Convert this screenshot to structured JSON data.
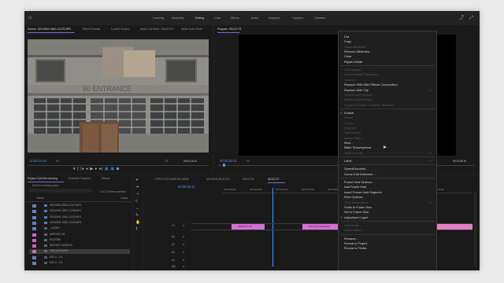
{
  "topbar": {
    "workspaces": [
      "Learning",
      "Assembly",
      "Editing",
      "Color",
      "Effects",
      "Audio",
      "Graphics",
      "Captions",
      "Libraries"
    ],
    "active": "Editing"
  },
  "source_panel": {
    "tabs": [
      "Source: 20210902-0840-C1175.MP4",
      "Effect Controls",
      "Lumetri Scopes",
      "Audio Clip Mixer: SELECTS",
      "Audio Track Mixer"
    ],
    "timecode": "13:03:11:04",
    "fit": "Fit",
    "scale": "1/2",
    "duration": "00:00:14:12",
    "sign_text": "60 ENTRANCE"
  },
  "program_panel": {
    "tab": "Program: SELECTS",
    "timecode": "00:00:20:11",
    "fit": "Fit",
    "scale": "1/2",
    "duration": "00:13:46:19"
  },
  "project_panel": {
    "tabs": [
      "Project: Ep2 this morning",
      "Essential Graphics",
      "Effects"
    ],
    "project_name": "Ep2 this morning.prproj",
    "item_count": "2 of 270 items selected",
    "column_name": "Name",
    "column_fps": "Frame",
    "items": [
      {
        "name": "20210903-1155-C1227.MP4",
        "color": "#5f7fd0",
        "type": "file"
      },
      {
        "name": "20210903-1155-C1228.MP4",
        "color": "#5f7fd0",
        "type": "file"
      },
      {
        "name": "20210903-1156-C1229.MP4",
        "color": "#5f7fd0",
        "type": "file"
      },
      {
        "name": "20210903-1203-C1230.MP4",
        "color": "#5f7fd0",
        "type": "file"
      },
      {
        "name": "_LOOKS",
        "color": "#5f7fd0",
        "type": "folder"
      },
      {
        "name": "AIRPORT US",
        "color": "#e05bcc",
        "type": "item"
      },
      {
        "name": "ROUTINE",
        "color": "#e05bcc",
        "type": "item"
      },
      {
        "name": "DRIVING GENERAL",
        "color": "#e05bcc",
        "type": "item"
      },
      {
        "name": "THIS MORNING",
        "color": "#e05bcc",
        "type": "item"
      },
      {
        "name": "DAY 1 - 0-4",
        "color": "#5f7fd0",
        "type": "folder"
      },
      {
        "name": "DAY 2 - 0-4",
        "color": "#5f7fd0",
        "type": "folder"
      }
    ]
  },
  "timeline": {
    "tabs": [
      "TYPPLE EP2 MASTER MODE",
      "ARCHIVE SELECTS",
      "SELECTS",
      "SELECTS"
    ],
    "timecode": "00:00:20:11",
    "ruler": [
      "00:00:00:00",
      "00:00:02:00",
      "00:00:04:00",
      "00:00:06:00",
      "00:00:08:00",
      "00:00:10:00",
      "00:00:12:00",
      "00:00:14:00",
      "00:00:16:00"
    ],
    "clips": [
      {
        "label": "AIRPORT US",
        "color": "#d66fd4"
      },
      {
        "label": "DRIVING GENERAL",
        "color": "#d66fd4"
      },
      {
        "label": "",
        "color": "#e27fc5"
      }
    ],
    "track_labels": [
      "V1",
      "A1",
      "A2",
      "A3",
      "A4",
      "Mix"
    ]
  },
  "context_menu": {
    "items": [
      {
        "label": "Cut",
        "disabled": false
      },
      {
        "label": "Copy",
        "disabled": false
      },
      {
        "label": "Paste Attributes...",
        "disabled": true
      },
      {
        "label": "Remove Attributes...",
        "disabled": false
      },
      {
        "label": "Clear",
        "disabled": false
      },
      {
        "label": "Ripple Delete",
        "disabled": false
      },
      {
        "sep": true
      },
      {
        "label": "Edit Original",
        "disabled": true
      },
      {
        "label": "Edit in Adobe Photoshop",
        "disabled": true
      },
      {
        "label": "License...",
        "disabled": true
      },
      {
        "label": "Replace With After Effects Composition",
        "disabled": false
      },
      {
        "label": "Replace With Clip",
        "disabled": false,
        "submenu": true
      },
      {
        "label": "Render and Replace...",
        "disabled": true
      },
      {
        "label": "Restore Unrendered",
        "disabled": true
      },
      {
        "label": "Export As Motion Graphics Template...",
        "disabled": true
      },
      {
        "sep": true
      },
      {
        "label": "Enable",
        "disabled": false,
        "checked": true
      },
      {
        "label": "Unlink",
        "disabled": true
      },
      {
        "label": "Group",
        "disabled": true
      },
      {
        "label": "Ungroup",
        "disabled": true
      },
      {
        "label": "Synchronize",
        "disabled": true
      },
      {
        "label": "Merge Clips...",
        "disabled": true
      },
      {
        "label": "Nest...",
        "disabled": false
      },
      {
        "label": "Make Subsequence",
        "disabled": false
      },
      {
        "label": "Multi-Camera",
        "disabled": true,
        "submenu": true
      },
      {
        "sep": true
      },
      {
        "label": "Label",
        "disabled": false,
        "submenu": true
      },
      {
        "sep": true
      },
      {
        "label": "Speed/Duration...",
        "disabled": false
      },
      {
        "label": "Scene Edit Detection...",
        "disabled": false
      },
      {
        "sep": true
      },
      {
        "label": "Frame Hold Options...",
        "disabled": false
      },
      {
        "label": "Add Frame Hold",
        "disabled": false
      },
      {
        "label": "Insert Frame Hold Segment",
        "disabled": false
      },
      {
        "label": "Field Options...",
        "disabled": false
      },
      {
        "label": "Time Interpolation",
        "disabled": true,
        "submenu": true
      },
      {
        "label": "Scale to Frame Size",
        "disabled": false
      },
      {
        "label": "Set to Frame Size",
        "disabled": false
      },
      {
        "label": "Adjustment Layer",
        "disabled": false,
        "checked": true
      },
      {
        "sep": true
      },
      {
        "label": "Link Media...",
        "disabled": true
      },
      {
        "label": "Make Offline...",
        "disabled": true
      },
      {
        "sep": true
      },
      {
        "label": "Rename...",
        "disabled": false
      },
      {
        "label": "Reveal in Project",
        "disabled": false
      },
      {
        "label": "Reveal in Finder...",
        "disabled": false
      }
    ]
  }
}
